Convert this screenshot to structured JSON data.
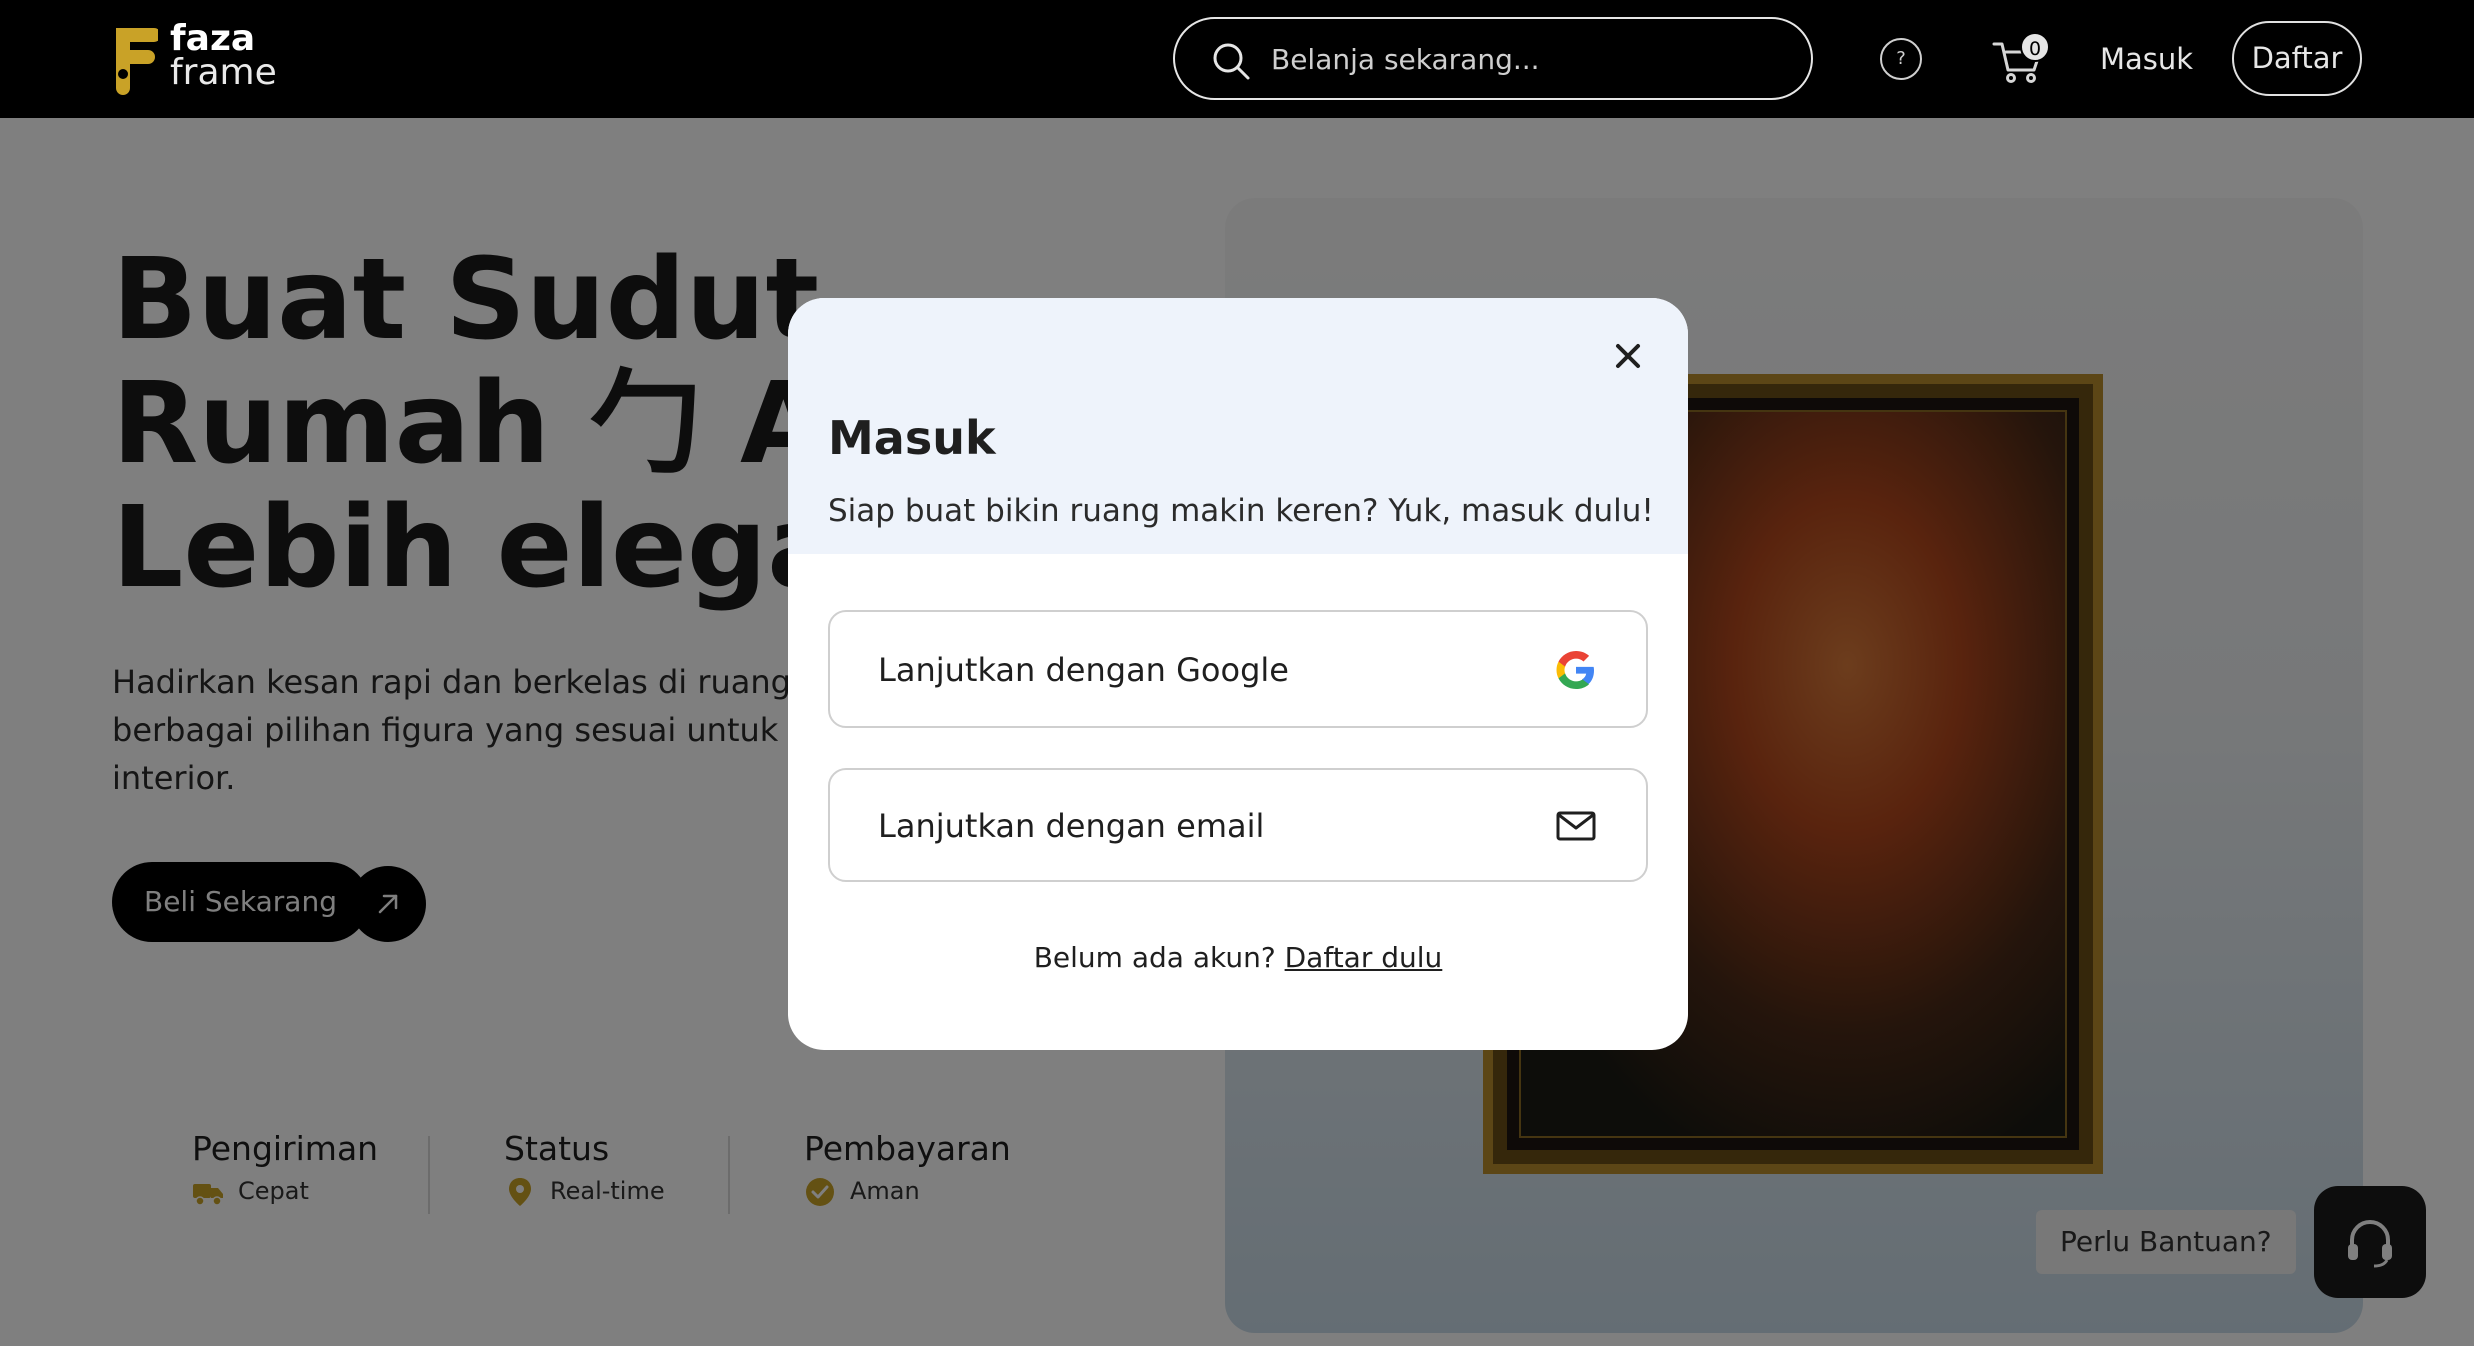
{
  "nav": {
    "logo_line1": "faza",
    "logo_line2": "frame",
    "search_placeholder": "Belanja sekarang...",
    "help_glyph": "?",
    "cart_count": "0",
    "login_label": "Masuk",
    "register_label": "Daftar"
  },
  "hero": {
    "headline": [
      "Buat Sudut",
      "Rumah ⼓ A",
      "Lebih elegan"
    ],
    "description": [
      "Hadirkan kesan rapi dan berkelas di ruangan A",
      "berbagai pilihan figura yang sesuai untuk berag",
      "interior."
    ],
    "cta_label": "Beli Sekarang",
    "features": [
      {
        "title": "Pengiriman",
        "subtitle": "Cepat",
        "icon": "truck-icon"
      },
      {
        "title": "Status",
        "subtitle": "Real-time",
        "icon": "location-pin-icon"
      },
      {
        "title": "Pembayaran",
        "subtitle": "Aman",
        "icon": "check-badge-icon"
      }
    ],
    "accent_color": "#c9a227"
  },
  "support": {
    "pill_label": "Perlu Bantuan?"
  },
  "modal": {
    "title": "Masuk",
    "subtitle": "Siap buat bikin ruang makin keren? Yuk, masuk dulu!",
    "google_label": "Lanjutkan dengan Google",
    "email_label": "Lanjutkan dengan email",
    "footer_text": "Belum ada akun?",
    "footer_link": "Daftar dulu"
  }
}
